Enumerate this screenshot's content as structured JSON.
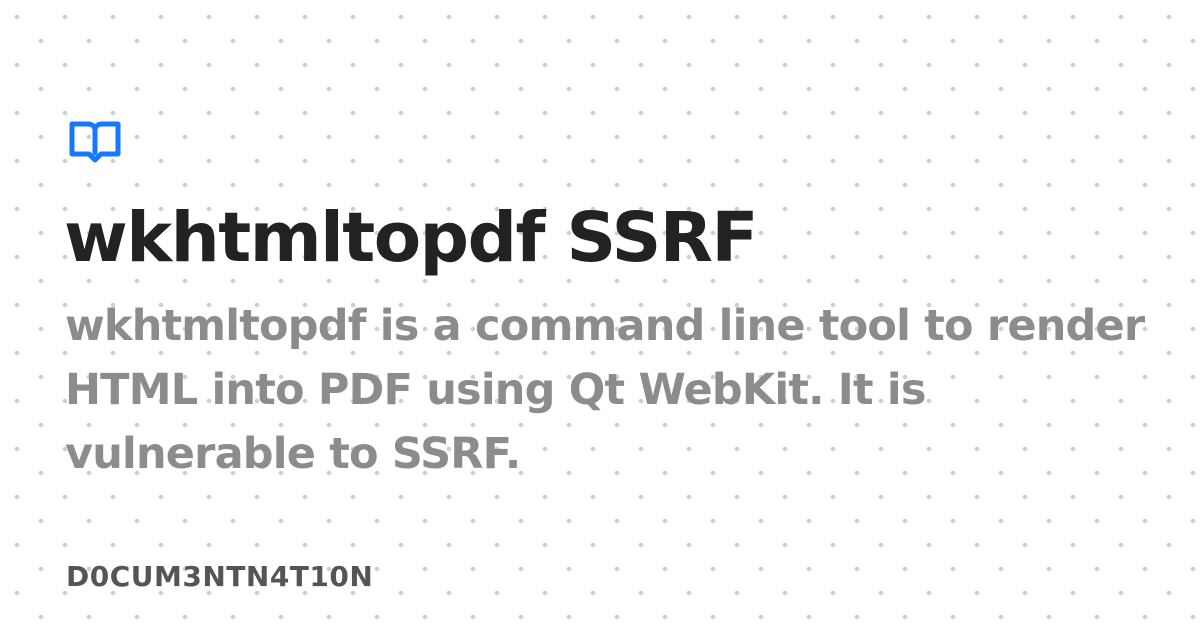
{
  "logo": {
    "icon": "open-book-icon",
    "color": "#1677ff"
  },
  "title": "wkhtmltopdf SSRF",
  "description": "wkhtmltopdf is a command line tool to render HTML into PDF using Qt WebKit. It is vulnerable to SSRF.",
  "site_name": "D0CUM3NTN4T10N",
  "colors": {
    "background": "#ffffff",
    "dots": "#cfcfcf",
    "title": "#222222",
    "description": "#8c8c8c",
    "site_name": "#555555"
  }
}
